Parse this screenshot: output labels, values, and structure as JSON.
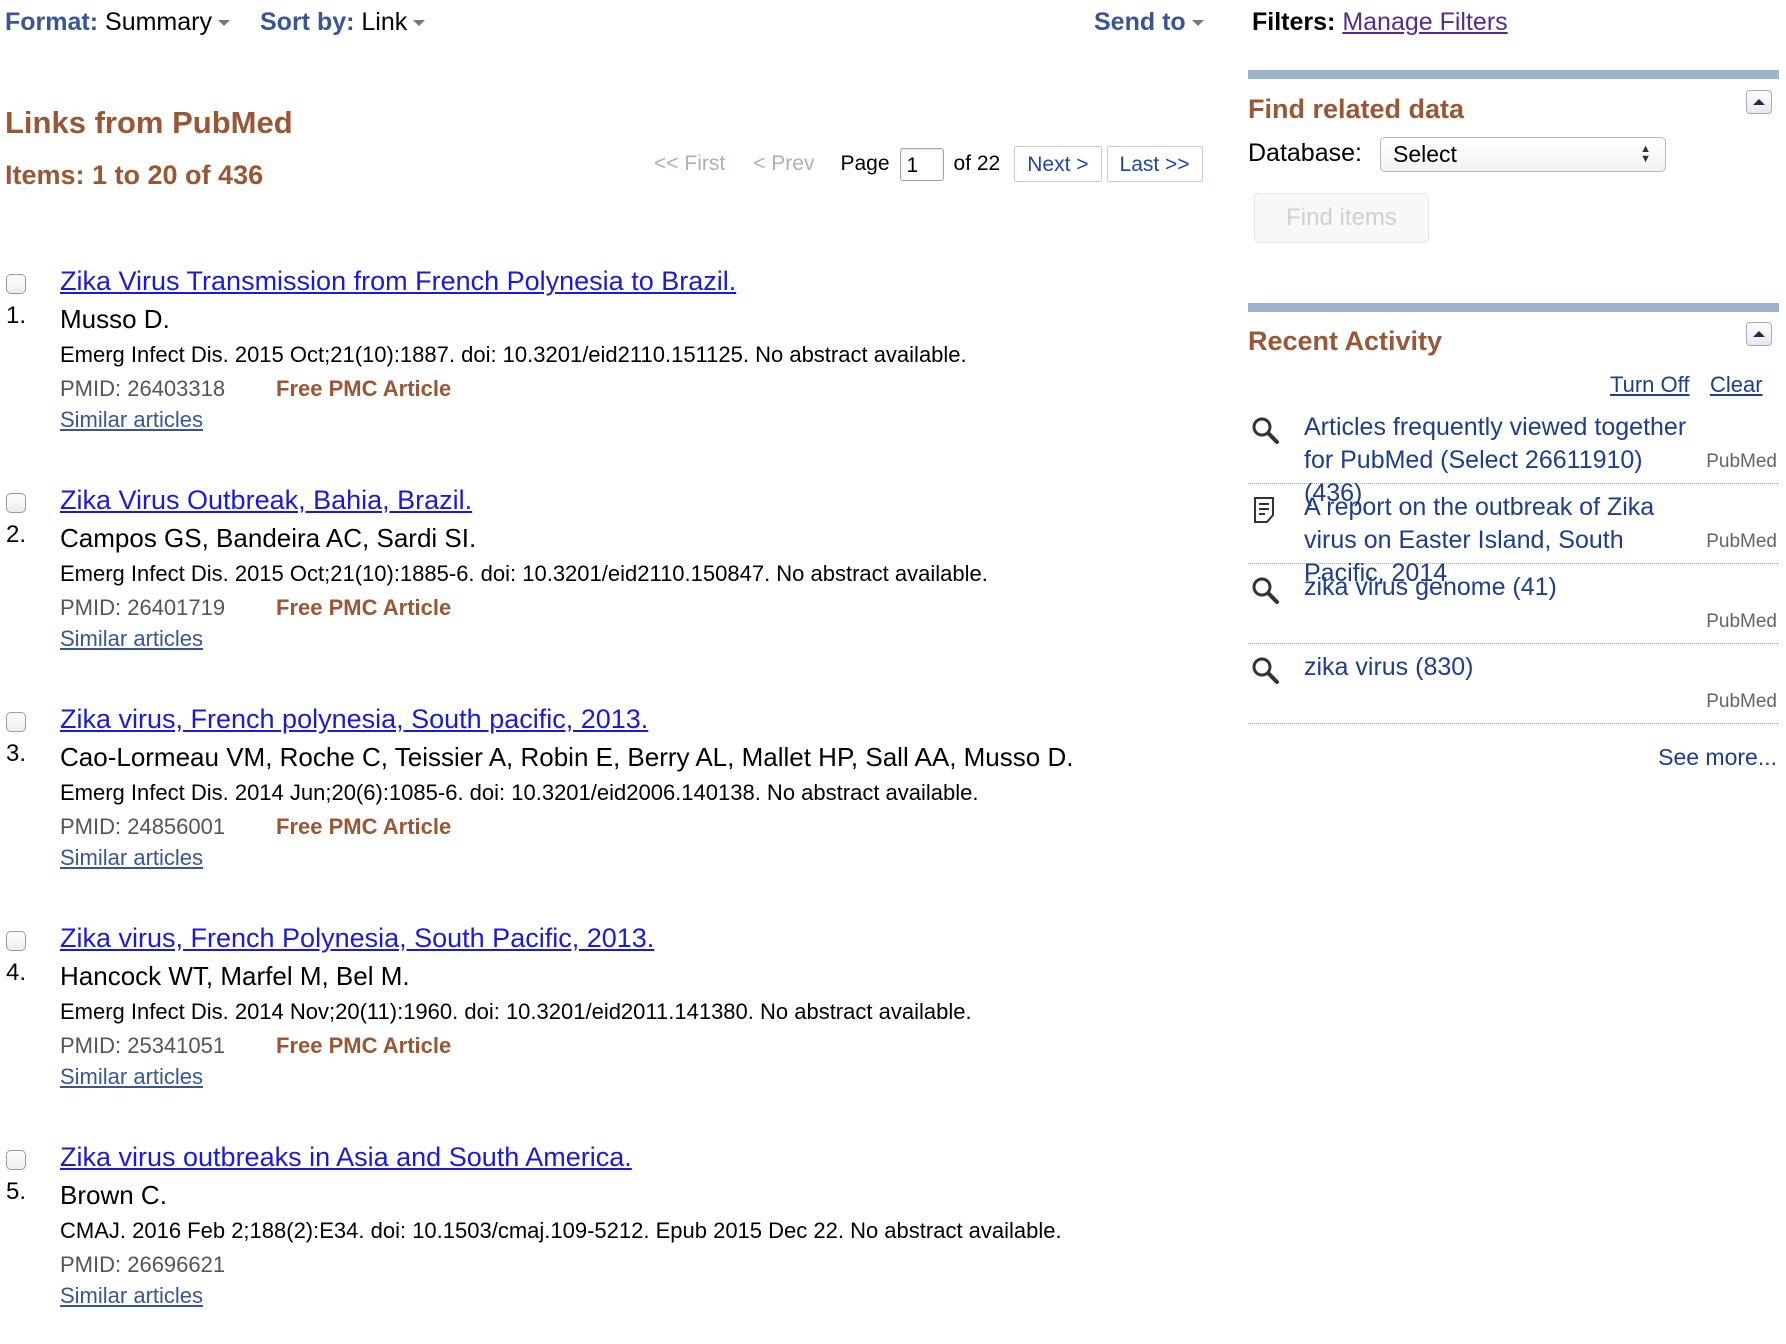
{
  "topbar": {
    "format_label": "Format:",
    "format_value": "Summary",
    "sortby_label": "Sort by:",
    "sortby_value": "Link",
    "sendto_label": "Send to",
    "filters_label": "Filters:",
    "manage_filters": "Manage Filters"
  },
  "main": {
    "heading": "Links from PubMed",
    "items_count": "Items: 1 to 20 of 436",
    "pager": {
      "first": "<< First",
      "prev": "< Prev",
      "page_label": "Page",
      "page_value": "1",
      "of_total": "of 22",
      "next": "Next >",
      "last": "Last >>"
    }
  },
  "results": [
    {
      "number": "1.",
      "title": "Zika Virus Transmission from French Polynesia to Brazil.",
      "authors": "Musso D.",
      "citation": "Emerg Infect Dis. 2015 Oct;21(10):1887. doi: 10.3201/eid2110.151125. No abstract available.",
      "pmid": "PMID: 26403318",
      "free_pmc": "Free PMC Article",
      "similar": "Similar articles"
    },
    {
      "number": "2.",
      "title": "Zika Virus Outbreak, Bahia, Brazil.",
      "authors": "Campos GS, Bandeira AC, Sardi SI.",
      "citation": "Emerg Infect Dis. 2015 Oct;21(10):1885-6. doi: 10.3201/eid2110.150847. No abstract available.",
      "pmid": "PMID: 26401719",
      "free_pmc": "Free PMC Article",
      "similar": "Similar articles"
    },
    {
      "number": "3.",
      "title": "Zika virus, French polynesia, South pacific, 2013.",
      "authors": "Cao-Lormeau VM, Roche C, Teissier A, Robin E, Berry AL, Mallet HP, Sall AA, Musso D.",
      "citation": "Emerg Infect Dis. 2014 Jun;20(6):1085-6. doi: 10.3201/eid2006.140138. No abstract available.",
      "pmid": "PMID: 24856001",
      "free_pmc": "Free PMC Article",
      "similar": "Similar articles"
    },
    {
      "number": "4.",
      "title": "Zika virus, French Polynesia, South Pacific, 2013.",
      "authors": "Hancock WT, Marfel M, Bel M.",
      "citation": "Emerg Infect Dis. 2014 Nov;20(11):1960. doi: 10.3201/eid2011.141380. No abstract available.",
      "pmid": "PMID: 25341051",
      "free_pmc": "Free PMC Article",
      "similar": "Similar articles"
    },
    {
      "number": "5.",
      "title": "Zika virus outbreaks in Asia and South America.",
      "authors": "Brown C.",
      "citation": "CMAJ. 2016 Feb 2;188(2):E34. doi: 10.1503/cmaj.109-5212. Epub 2015 Dec 22. No abstract available.",
      "pmid": "PMID: 26696621",
      "free_pmc": "",
      "similar": "Similar articles"
    }
  ],
  "sidebar": {
    "find_related": {
      "title": "Find related data",
      "database_label": "Database:",
      "database_value": "Select",
      "find_button": "Find items"
    },
    "recent_activity": {
      "title": "Recent Activity",
      "turn_off": "Turn Off",
      "clear": "Clear",
      "items": [
        {
          "icon": "search-icon",
          "text": "Articles frequently viewed together for PubMed (Select 26611910) (436)",
          "db": "PubMed"
        },
        {
          "icon": "document-icon",
          "text": "A report on the outbreak of Zika virus on Easter Island, South Pacific, 2014",
          "db": "PubMed"
        },
        {
          "icon": "search-icon",
          "text": "zika virus genome (41)",
          "db": "PubMed"
        },
        {
          "icon": "search-icon",
          "text": "zika virus (830)",
          "db": "PubMed"
        }
      ],
      "see_more": "See more..."
    }
  }
}
